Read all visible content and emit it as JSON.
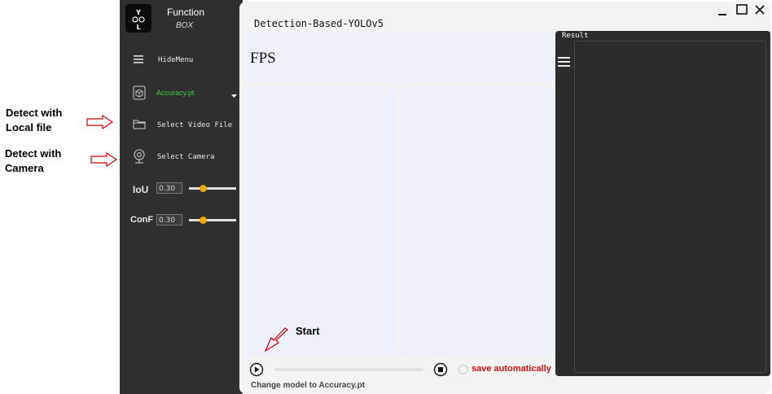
{
  "annotations": {
    "local_file": "Detect with\nLocal file",
    "camera": "Detect with\nCamera",
    "start": "Start"
  },
  "sidebar": {
    "brand_title": "Function",
    "brand_subtitle": "BOX",
    "logo_text": "YOLO",
    "hide_menu": "HideMenu",
    "model": "Accuracy.pt",
    "select_video": "Select Video File",
    "select_camera": "Select Camera",
    "iou_label": "IoU",
    "iou_value": "0.30",
    "iou_level": 0.3,
    "conf_label": "ConF",
    "conf_value": "0.30",
    "conf_level": 0.3
  },
  "window": {
    "title": "Detection-Based-YOLOv5",
    "minimize": "—",
    "maximize": "☐",
    "close": "✕"
  },
  "main": {
    "fps_label": "FPS",
    "result_label": "Result",
    "save_auto": "save automatically",
    "status": "Change model to Accuracy.pt"
  },
  "colors": {
    "sidebar_bg": "#2f2f2f",
    "model_green": "#40d040",
    "slider_knob": "#f0a800",
    "save_red": "#d01010",
    "annotation_arrow": "#cc0000"
  }
}
